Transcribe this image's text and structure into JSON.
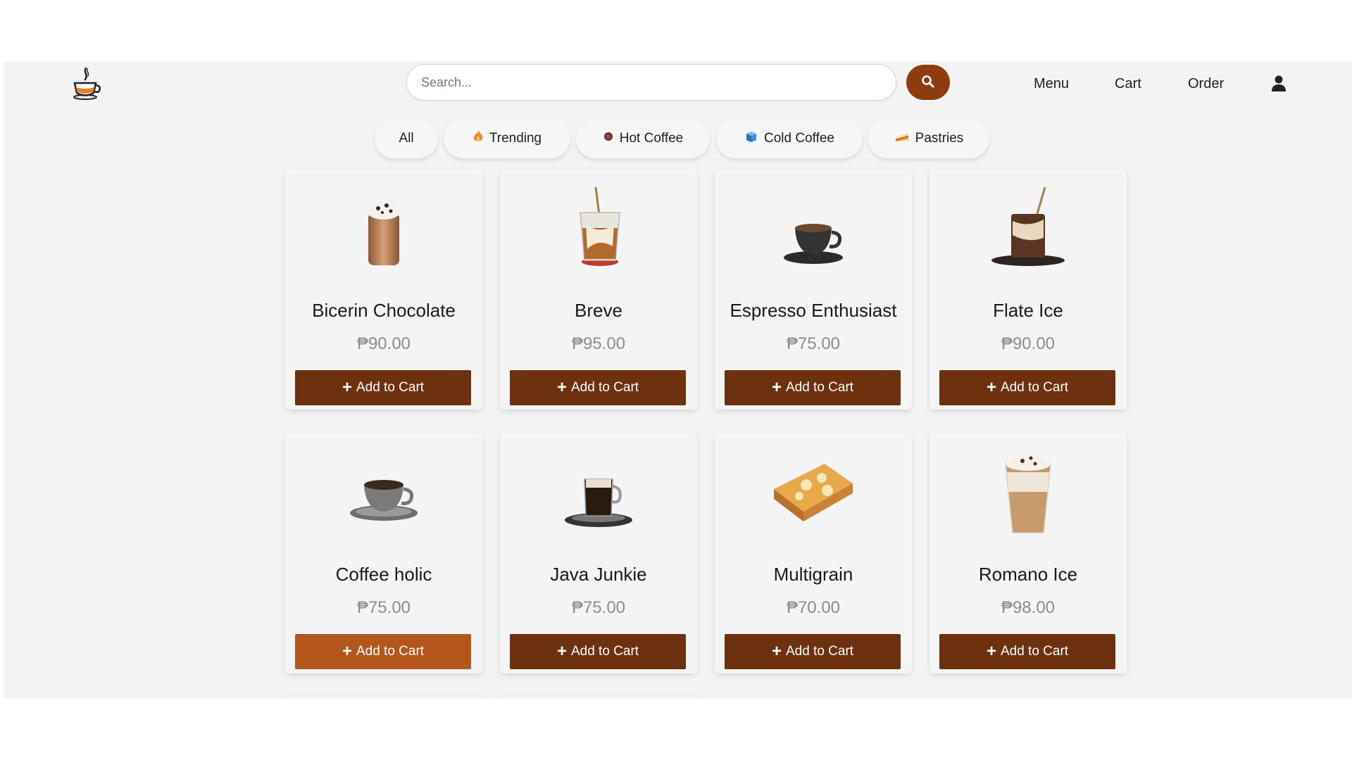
{
  "header": {
    "logo_icon": "coffee-cup-logo-icon",
    "search": {
      "placeholder": "Search...",
      "value": "",
      "button_icon": "search-icon"
    },
    "nav": {
      "menu": "Menu",
      "cart": "Cart",
      "order": "Order",
      "user_icon": "user-icon"
    }
  },
  "categories": [
    {
      "label": "All",
      "icon": ""
    },
    {
      "label": "Trending",
      "icon": "fire-icon"
    },
    {
      "label": "Hot Coffee",
      "icon": "hot-coffee-icon"
    },
    {
      "label": "Cold Coffee",
      "icon": "ice-cube-icon"
    },
    {
      "label": "Pastries",
      "icon": "cake-icon"
    }
  ],
  "products": [
    {
      "name": "Bicerin Chocolate",
      "price": "₱90.00",
      "button": "Add to Cart",
      "image": "frappe-icon"
    },
    {
      "name": "Breve",
      "price": "₱95.00",
      "button": "Add to Cart",
      "image": "iced-latte-icon"
    },
    {
      "name": "Espresso Enthusiast",
      "price": "₱75.00",
      "button": "Add to Cart",
      "image": "espresso-cup-icon"
    },
    {
      "name": "Flate Ice",
      "price": "₱90.00",
      "button": "Add to Cart",
      "image": "iced-coffee-icon"
    },
    {
      "name": "Coffee holic",
      "price": "₱75.00",
      "button": "Add to Cart",
      "image": "coffee-cup-icon"
    },
    {
      "name": "Java Junkie",
      "price": "₱75.00",
      "button": "Add to Cart",
      "image": "glass-coffee-icon"
    },
    {
      "name": "Multigrain",
      "price": "₱70.00",
      "button": "Add to Cart",
      "image": "pastry-icon"
    },
    {
      "name": "Romano Ice",
      "price": "₱98.00",
      "button": "Add to Cart",
      "image": "iced-cappuccino-icon"
    }
  ],
  "colors": {
    "accent": "#8e3c0f",
    "button": "#6e3110",
    "button_active": "#b4551b",
    "background": "#f3f3f3",
    "price": "#8c8c8c"
  }
}
